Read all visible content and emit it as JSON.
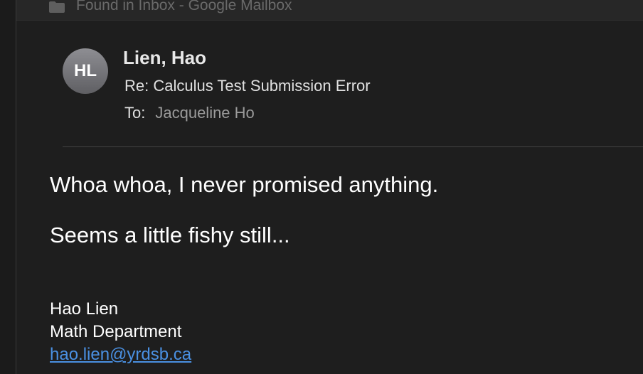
{
  "topbar": {
    "label": "Found in Inbox - Google Mailbox",
    "icon": "folder-icon"
  },
  "header": {
    "avatar_initials": "HL",
    "sender": "Lien, Hao",
    "subject": "Re: Calculus Test Submission Error",
    "to_label": "To:",
    "to_value": "Jacqueline Ho"
  },
  "body": {
    "line1": "Whoa whoa, I never promised anything.",
    "line2": "Seems a little fishy still..."
  },
  "signature": {
    "name": "Hao Lien",
    "department": "Math Department",
    "email": "hao.lien@yrdsb.ca"
  },
  "colors": {
    "background": "#1e1e1e",
    "link": "#4a90e2",
    "avatar": "#7a7a7e"
  }
}
